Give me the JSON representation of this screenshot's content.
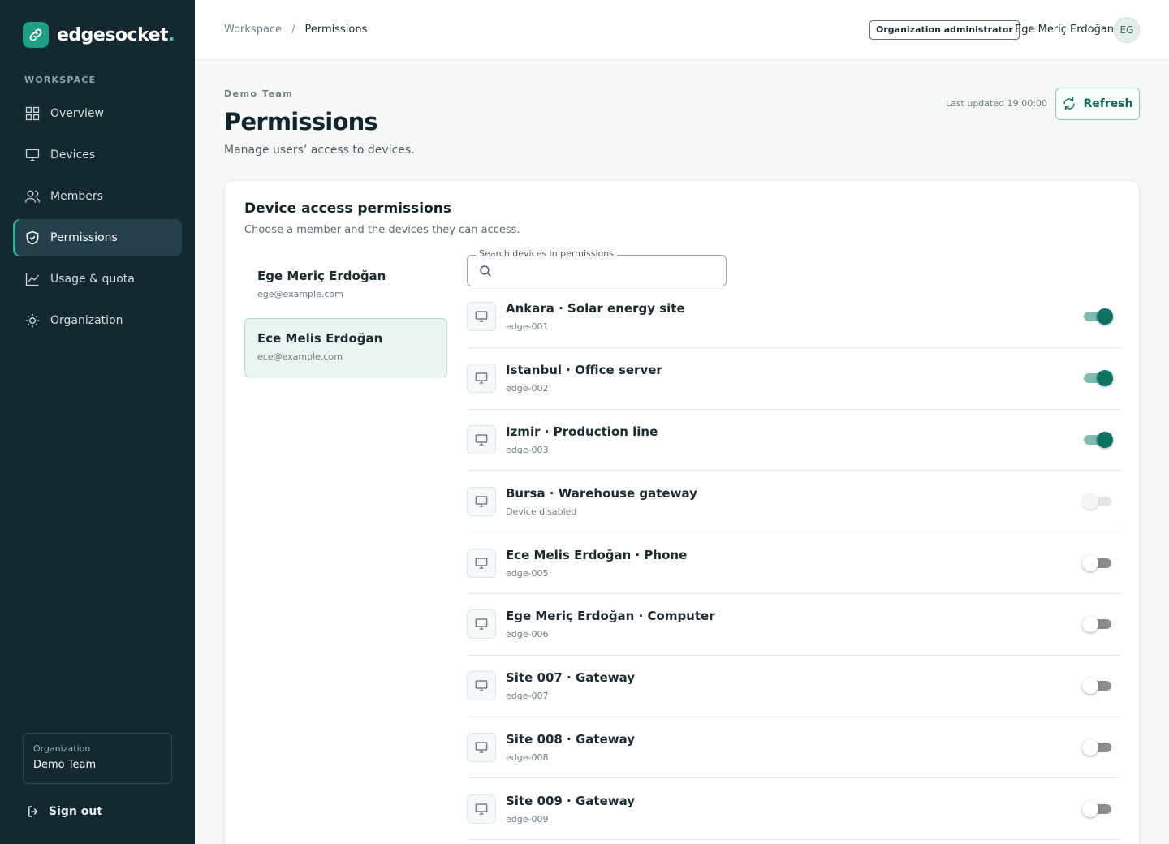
{
  "brand": {
    "name": "edgesocket",
    "dot": "."
  },
  "sidebar": {
    "section_label": "WORKSPACE",
    "items": [
      {
        "label": "Overview",
        "icon": "grid-icon"
      },
      {
        "label": "Devices",
        "icon": "monitor-icon"
      },
      {
        "label": "Members",
        "icon": "users-icon"
      },
      {
        "label": "Permissions",
        "icon": "shield-icon",
        "active": true
      },
      {
        "label": "Usage & quota",
        "icon": "chart-line-icon"
      },
      {
        "label": "Organization",
        "icon": "sun-icon"
      }
    ],
    "org": {
      "label": "Organization",
      "name": "Demo Team"
    },
    "signout_label": "Sign out"
  },
  "topbar": {
    "breadcrumb": [
      "Workspace",
      "Permissions"
    ],
    "role_badge": "Organization administrator",
    "user_name": "Ege Meriç Erdoğan",
    "avatar_initials": "EG"
  },
  "header": {
    "team": "Demo Team",
    "title": "Permissions",
    "subtitle": "Manage users’ access to devices.",
    "last_updated": "Last updated 19:00:00",
    "refresh_label": "Refresh"
  },
  "card": {
    "title": "Device access permissions",
    "subtitle": "Choose a member and the devices they can access."
  },
  "members": [
    {
      "name": "Ege Meriç Erdoğan",
      "email": "ege@example.com",
      "selected": false
    },
    {
      "name": "Ece Melis Erdoğan",
      "email": "ece@example.com",
      "selected": true
    }
  ],
  "search": {
    "label": "Search devices in permissions",
    "value": "",
    "placeholder": ""
  },
  "devices": [
    {
      "name": "Ankara · Solar energy site",
      "sub": "edge-001",
      "enabled": true,
      "disabled": false
    },
    {
      "name": "Istanbul · Office server",
      "sub": "edge-002",
      "enabled": true,
      "disabled": false
    },
    {
      "name": "Izmir · Production line",
      "sub": "edge-003",
      "enabled": true,
      "disabled": false
    },
    {
      "name": "Bursa · Warehouse gateway",
      "sub": "Device disabled",
      "enabled": false,
      "disabled": true
    },
    {
      "name": "Ece Melis Erdoğan · Phone",
      "sub": "edge-005",
      "enabled": false,
      "disabled": false
    },
    {
      "name": "Ege Meriç Erdoğan · Computer",
      "sub": "edge-006",
      "enabled": false,
      "disabled": false
    },
    {
      "name": "Site 007 · Gateway",
      "sub": "edge-007",
      "enabled": false,
      "disabled": false
    },
    {
      "name": "Site 008 · Gateway",
      "sub": "edge-008",
      "enabled": false,
      "disabled": false
    },
    {
      "name": "Site 009 · Gateway",
      "sub": "edge-009",
      "enabled": false,
      "disabled": false
    }
  ],
  "colors": {
    "sidebar_bg": "#13282f",
    "accent": "#0f7262",
    "accent_light": "#7fbcae",
    "brand_dot": "#2bd3a8"
  }
}
